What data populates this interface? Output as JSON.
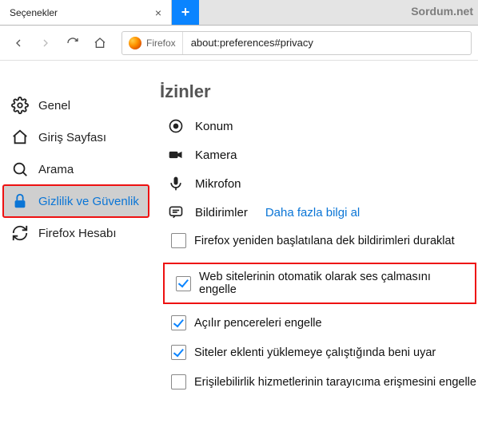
{
  "tab": {
    "title": "Seçenekler"
  },
  "watermark": "Sordum.net",
  "url": {
    "brand": "Firefox",
    "path": "about:preferences#privacy"
  },
  "sidebar": {
    "items": [
      {
        "label": "Genel"
      },
      {
        "label": "Giriş Sayfası"
      },
      {
        "label": "Arama"
      },
      {
        "label": "Gizlilik ve Güvenlik"
      },
      {
        "label": "Firefox Hesabı"
      }
    ]
  },
  "content": {
    "section_title": "İzinler",
    "perms": {
      "location": "Konum",
      "camera": "Kamera",
      "microphone": "Mikrofon",
      "notifications": "Bildirimler",
      "notifications_link": "Daha fazla bilgi al"
    },
    "checks": {
      "pause_notifs": "Firefox yeniden başlatılana dek bildirimleri duraklat",
      "block_autoplay": "Web sitelerinin otomatik olarak ses çalmasını engelle",
      "block_popups": "Açılır pencereleri engelle",
      "warn_addons": "Siteler eklenti yüklemeye çalıştığında beni uyar",
      "block_a11y": "Erişilebilirlik hizmetlerinin tarayıcıma erişmesini engelle"
    }
  }
}
